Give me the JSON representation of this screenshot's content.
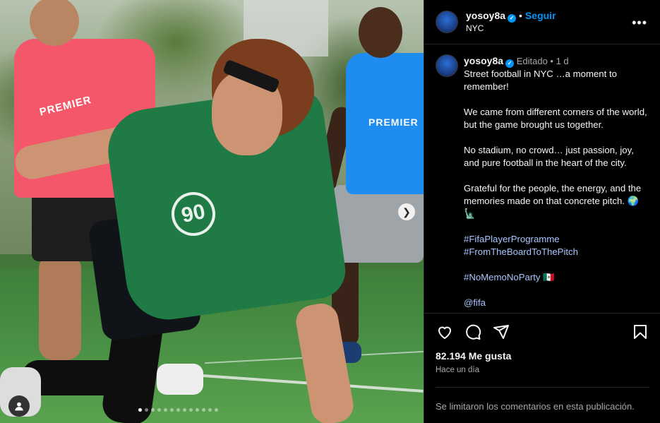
{
  "post": {
    "author": {
      "username": "yosoy8a",
      "verified_icon": "verified-badge-icon",
      "follow_label": "Seguir",
      "location": "NYC"
    },
    "more_options_icon": "more-horizontal-icon",
    "media": {
      "next_icon": "chevron-right-icon",
      "tag_icon": "user-tag-icon",
      "shirt_text_red": "PREMIER",
      "shirt_text_blue": "PREMIER",
      "shirt_badge": "90",
      "carousel_count": 13,
      "carousel_active_index": 0
    },
    "caption": {
      "username": "yosoy8a",
      "edited_label": "Editado",
      "age": "1 d",
      "lines": [
        "Street football in NYC …a moment to remember!",
        "",
        "We came from different corners of the world, but the game brought us together.",
        "",
        "No stadium, no crowd… just passion, joy, and pure football in the heart of the city.",
        "",
        "Grateful for the people, the energy, and the memories made on that concrete pitch. 🌍 🗽",
        ""
      ],
      "hashtags": [
        "#FifaPlayerProgramme",
        "#FromTheBoardToThePitch"
      ],
      "hashtag2": "#NoMemoNoParty 🇲🇽",
      "mention": "@fifa"
    },
    "actions": {
      "like_icon": "heart-icon",
      "comment_icon": "comment-icon",
      "share_icon": "send-icon",
      "save_icon": "bookmark-icon"
    },
    "likes_text": "82.194 Me gusta",
    "time_text": "Hace un día",
    "comments_restricted": "Se limitaron los comentarios en esta publicación."
  }
}
